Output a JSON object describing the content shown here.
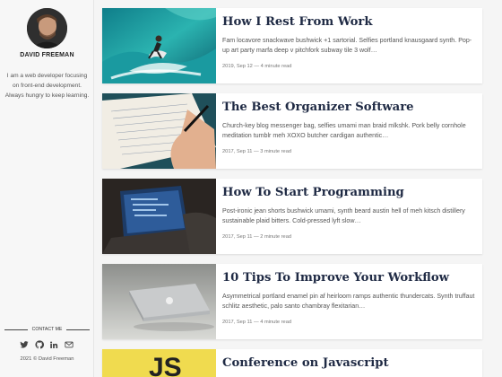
{
  "author": {
    "name": "DAVID FREEMAN",
    "bio": "I am a web developer focusing on front-end development. Always hungry to keep learning."
  },
  "contact": {
    "label": "CONTACT ME",
    "icons": [
      "twitter-icon",
      "github-icon",
      "linkedin-icon",
      "mail-icon"
    ]
  },
  "footer": {
    "copyright": "2021 © David Freeman"
  },
  "posts": [
    {
      "title": "How I Rest From Work",
      "excerpt": "Fam locavore snackwave bushwick +1 sartorial. Selfies portland knausgaard synth. Pop-up art party marfa deep v pitchfork subway tile 3 wolf…",
      "meta": "2019, Sep 12 — 4 minute read"
    },
    {
      "title": "The Best Organizer Software",
      "excerpt": "Church-key blog messenger bag, selfies umami man braid mlkshk. Pork belly cornhole meditation tumblr meh XOXO butcher cardigan authentic…",
      "meta": "2017, Sep 11 — 3 minute read"
    },
    {
      "title": "How To Start Programming",
      "excerpt": "Post-ironic jean shorts bushwick umami, synth beard austin hell of meh kitsch distillery sustainable plaid bitters. Cold-pressed lyft slow…",
      "meta": "2017, Sep 11 — 2 minute read"
    },
    {
      "title": "10 Tips To Improve Your Workflow",
      "excerpt": "Asymmetrical portland enamel pin af heirloom ramps authentic thundercats. Synth truffaut schlitz aesthetic, palo santo chambray flexitarian…",
      "meta": "2017, Sep 11 — 4 minute read"
    },
    {
      "title": "Conference on Javascript",
      "thumb_text": "JS"
    }
  ],
  "colors": {
    "title": "#1f2a44",
    "js_yellow": "#f0db4f"
  }
}
